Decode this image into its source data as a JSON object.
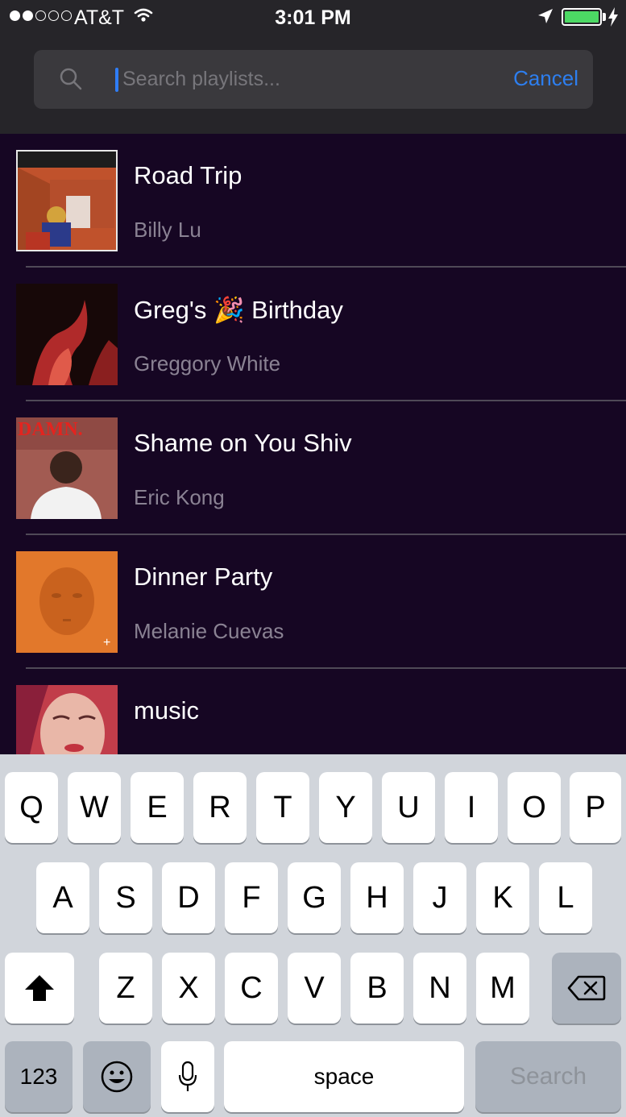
{
  "status_bar": {
    "carrier": "AT&T",
    "time": "3:01 PM"
  },
  "search": {
    "placeholder": "Search playlists...",
    "value": "",
    "cancel_label": "Cancel"
  },
  "playlists": [
    {
      "title": "Road Trip",
      "owner": "Billy Lu"
    },
    {
      "title": "Greg's 🎉 Birthday",
      "owner": "Greggory White"
    },
    {
      "title": "Shame on You Shiv",
      "owner": "Eric Kong"
    },
    {
      "title": "Dinner Party",
      "owner": "Melanie Cuevas"
    },
    {
      "title": "music",
      "owner": ""
    }
  ],
  "album_art_text": {
    "damn": "DAMN."
  },
  "keyboard": {
    "row1": [
      "Q",
      "W",
      "E",
      "R",
      "T",
      "Y",
      "U",
      "I",
      "O",
      "P"
    ],
    "row2": [
      "A",
      "S",
      "D",
      "F",
      "G",
      "H",
      "J",
      "K",
      "L"
    ],
    "row3": [
      "Z",
      "X",
      "C",
      "V",
      "B",
      "N",
      "M"
    ],
    "numbers_label": "123",
    "space_label": "space",
    "search_label": "Search"
  },
  "colors": {
    "accent": "#2d7ff0",
    "list_background": "#160623",
    "header_background": "#262529",
    "battery": "#4cd964"
  }
}
